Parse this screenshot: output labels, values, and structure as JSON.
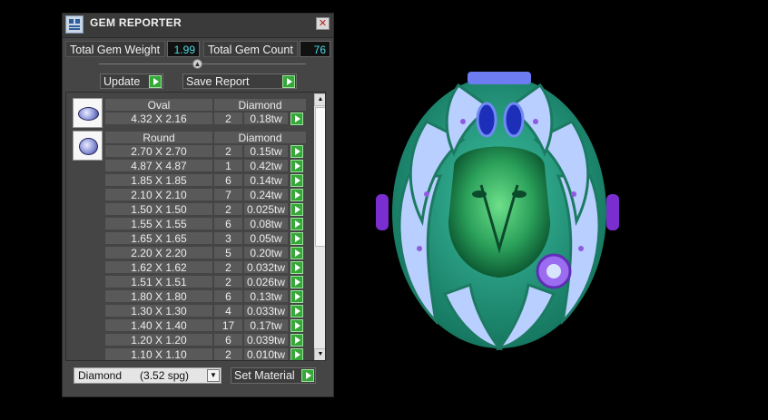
{
  "window": {
    "title": "GEM REPORTER",
    "close_glyph": "✕"
  },
  "totals": {
    "weight_label": "Total Gem Weight",
    "weight_value": "1.99",
    "count_label": "Total Gem Count",
    "count_value": "76"
  },
  "buttons": {
    "update": "Update",
    "save_report": "Save Report",
    "set_material": "Set Material"
  },
  "groups": [
    {
      "shape": "Oval",
      "material": "Diamond",
      "rows": [
        {
          "size": "4.32 X 2.16",
          "count": "2",
          "weight": "0.18tw"
        }
      ]
    },
    {
      "shape": "Round",
      "material": "Diamond",
      "rows": [
        {
          "size": "2.70 X 2.70",
          "count": "2",
          "weight": "0.15tw"
        },
        {
          "size": "4.87 X 4.87",
          "count": "1",
          "weight": "0.42tw"
        },
        {
          "size": "1.85 X 1.85",
          "count": "6",
          "weight": "0.14tw"
        },
        {
          "size": "2.10 X 2.10",
          "count": "7",
          "weight": "0.24tw"
        },
        {
          "size": "1.50 X 1.50",
          "count": "2",
          "weight": "0.025tw"
        },
        {
          "size": "1.55 X 1.55",
          "count": "6",
          "weight": "0.08tw"
        },
        {
          "size": "1.65 X 1.65",
          "count": "3",
          "weight": "0.05tw"
        },
        {
          "size": "2.20 X 2.20",
          "count": "5",
          "weight": "0.20tw"
        },
        {
          "size": "1.62 X 1.62",
          "count": "2",
          "weight": "0.032tw"
        },
        {
          "size": "1.51 X 1.51",
          "count": "2",
          "weight": "0.026tw"
        },
        {
          "size": "1.80 X 1.80",
          "count": "6",
          "weight": "0.13tw"
        },
        {
          "size": "1.30 X 1.30",
          "count": "4",
          "weight": "0.033tw"
        },
        {
          "size": "1.40 X 1.40",
          "count": "17",
          "weight": "0.17tw"
        },
        {
          "size": "1.20 X 1.20",
          "count": "6",
          "weight": "0.039tw"
        },
        {
          "size": "1.10 X 1.10",
          "count": "2",
          "weight": "0.010tw"
        }
      ]
    }
  ],
  "material_select": {
    "value": "Diamond      (3.52 spg)"
  },
  "icons": {
    "app": "gem-reporter-icon",
    "close": "close-icon",
    "collapse": "collapse-arrow-icon",
    "go": "green-play-arrow-icon",
    "oval_gem": "oval-gem-icon",
    "round_gem": "round-gem-icon",
    "scroll_up": "scroll-up-arrow-icon",
    "scroll_down": "scroll-down-arrow-icon",
    "dropdown": "dropdown-arrow-icon"
  },
  "colors": {
    "panel": "#454545",
    "cell": "#595959",
    "value_text": "#4fd8e0",
    "go_button": "#36a83a",
    "model_green": "#2fae5e",
    "model_blue": "#a9c6ff",
    "model_purple": "#7a3ed6"
  }
}
